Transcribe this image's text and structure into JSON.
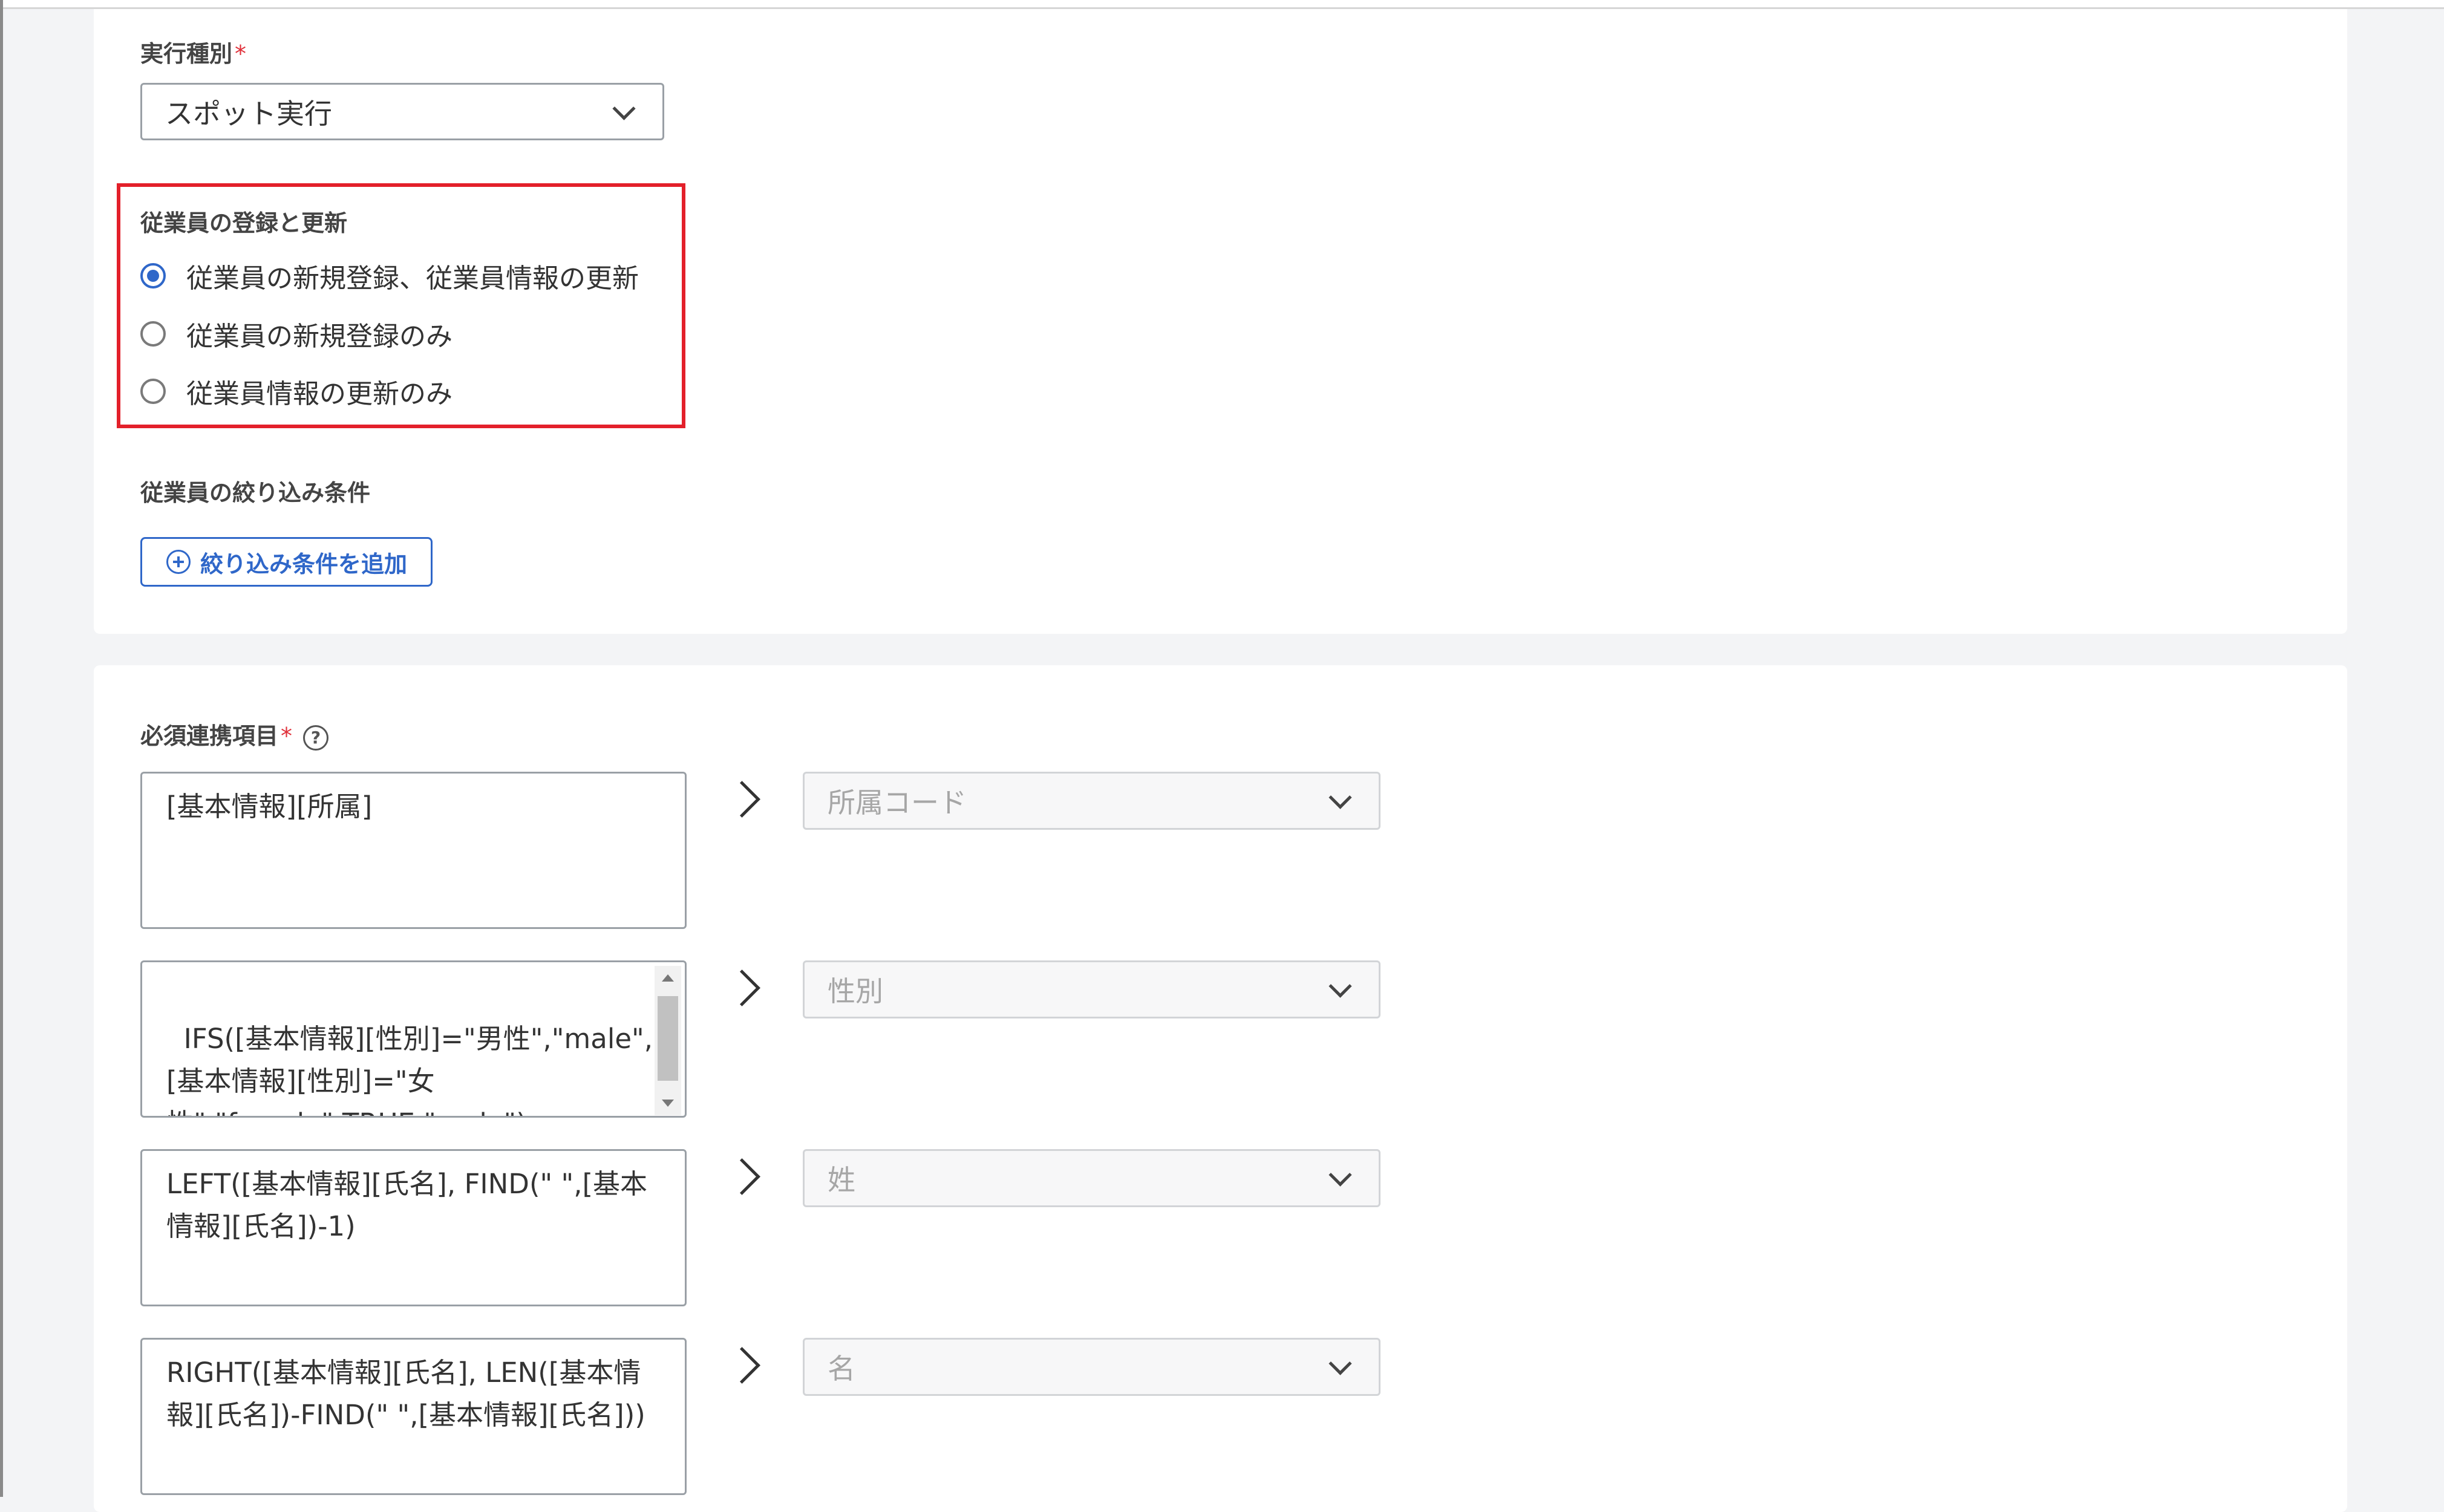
{
  "execution_type": {
    "label": "実行種別",
    "required_mark": "*",
    "selected": "スポット実行"
  },
  "employee_update": {
    "label": "従業員の登録と更新",
    "options": [
      {
        "label": "従業員の新規登録、従業員情報の更新",
        "checked": true
      },
      {
        "label": "従業員の新規登録のみ",
        "checked": false
      },
      {
        "label": "従業員情報の更新のみ",
        "checked": false
      }
    ]
  },
  "filter": {
    "label": "従業員の絞り込み条件",
    "add_button": "絞り込み条件を追加"
  },
  "required_mapping": {
    "label": "必須連携項目",
    "required_mark": "*",
    "help_icon": "?",
    "rows": [
      {
        "formula": "[基本情報][所属]",
        "target": "所属コード"
      },
      {
        "formula": "IFS([基本情報][性別]=\"男性\",\"male\",\n[基本情報][性別]=\"女\n性\",\"female\",TRUE,\"male\")",
        "target": "性別"
      },
      {
        "formula": "LEFT([基本情報][氏名], FIND(\" \",[基本\n情報][氏名])-1)",
        "target": "姓"
      },
      {
        "formula": "RIGHT([基本情報][氏名], LEN([基本情\n報][氏名])-FIND(\" \",[基本情報][氏名]))",
        "target": "名"
      }
    ]
  },
  "colors": {
    "accent": "#2f67c9",
    "highlight": "#e3202a",
    "required": "#e0303a"
  }
}
